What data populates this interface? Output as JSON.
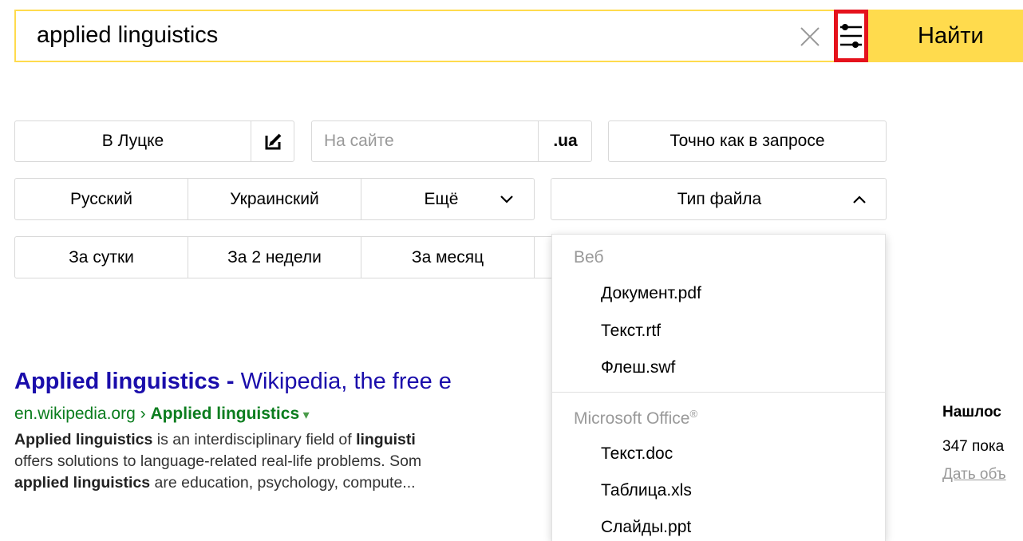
{
  "search": {
    "query": "applied linguistics",
    "find_label": "Найти"
  },
  "filters": {
    "region": "В Луцке",
    "site_placeholder": "На сайте",
    "domain": ".ua",
    "exact": "Точно как в запросе",
    "languages": [
      "Русский",
      "Украинский",
      "Ещё"
    ],
    "file_type": "Тип файла",
    "periods": [
      "За сутки",
      "За 2 недели",
      "За месяц"
    ]
  },
  "dropdown": {
    "group_web": "Веб",
    "web_items": [
      "Документ.pdf",
      "Текст.rtf",
      "Флеш.swf"
    ],
    "group_office": "Microsoft Office",
    "office_sup": "®",
    "office_items": [
      "Текст.doc",
      "Таблица.xls",
      "Слайды.ppt"
    ]
  },
  "result": {
    "title_bold": "Applied linguistics -",
    "title_rest": " Wikipedia, the free e",
    "url_host": "en.wikipedia.org",
    "url_sep": " › ",
    "url_path": "Applied linguistics",
    "url_arrow": " ▾",
    "snippet": [
      {
        "b": "Applied linguistics",
        "t": " is an interdisciplinary field of "
      },
      {
        "b": "linguisti",
        "t": ""
      },
      {
        "b": "",
        "t": "offers solutions to language-related real-life problems. Som"
      },
      {
        "b": "applied linguistics",
        "t": " are education, psychology, compute..."
      }
    ]
  },
  "sidebar": {
    "line1": "Нашлос",
    "line2": "347 пока",
    "line3": "Дать объ"
  }
}
